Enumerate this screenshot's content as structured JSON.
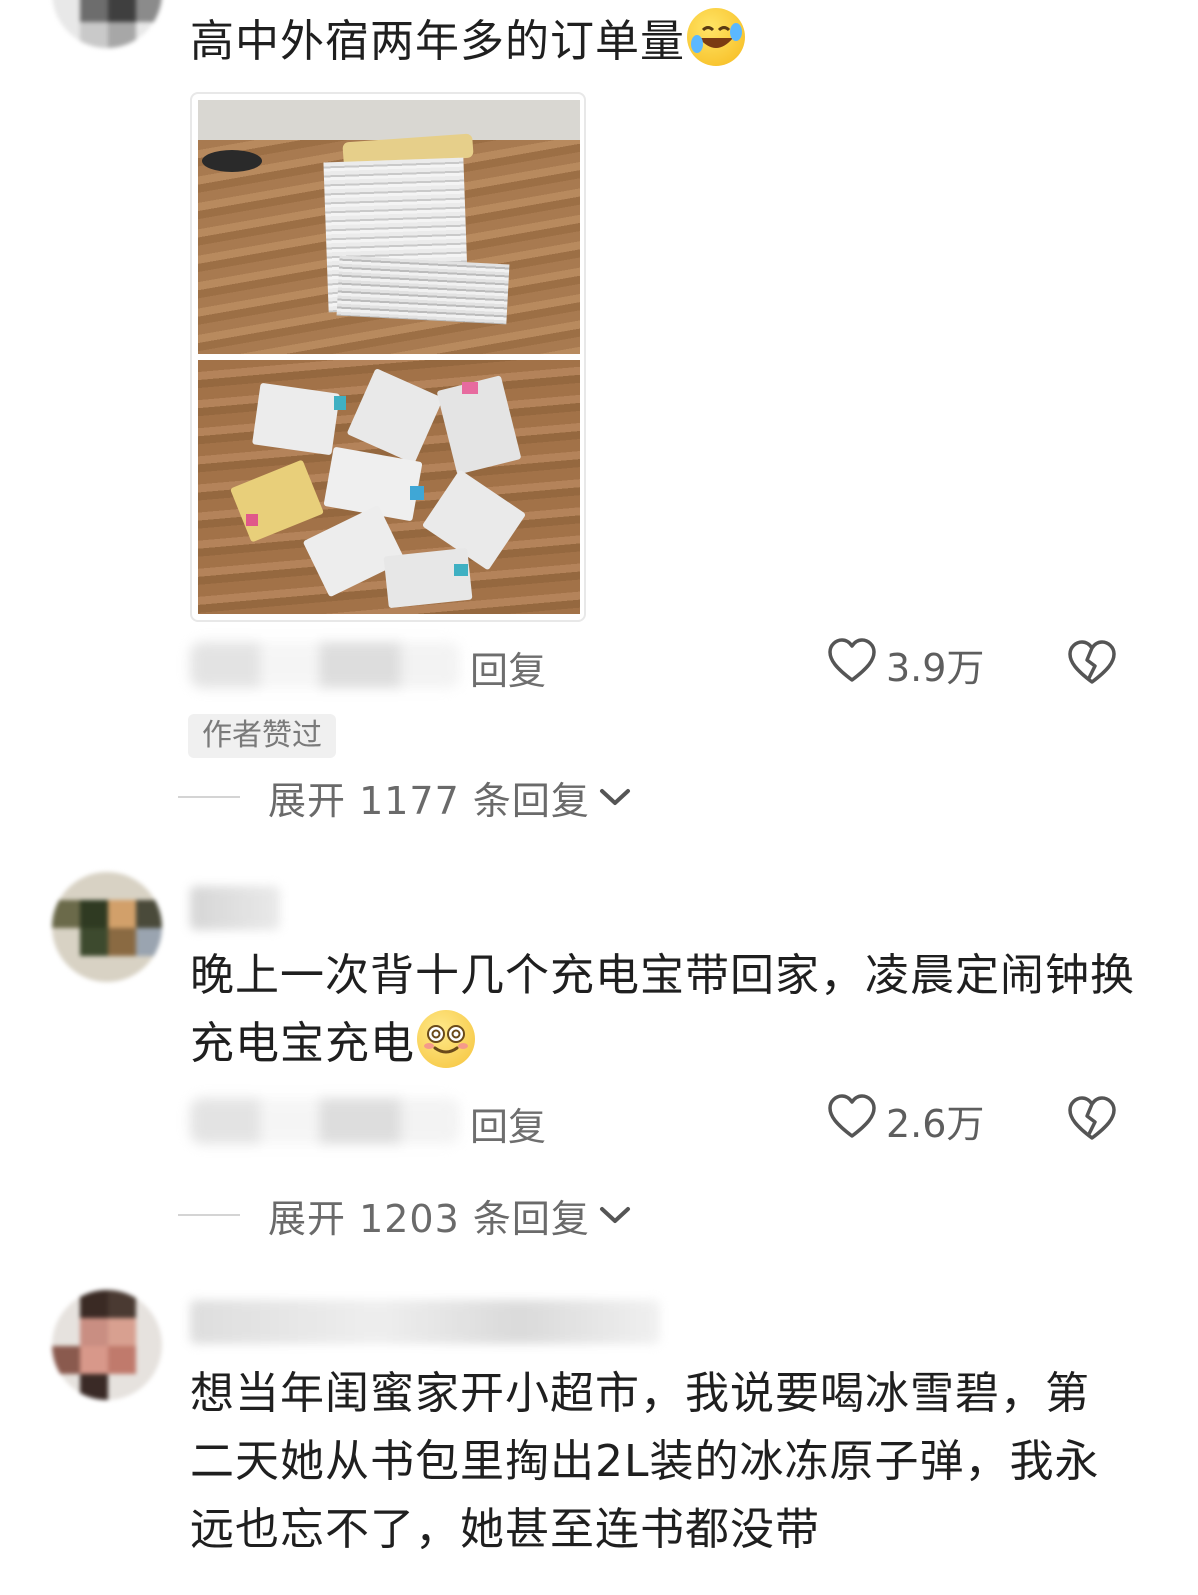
{
  "comments": [
    {
      "text": "高中外宿两年多的订单量",
      "reply_label": "回复",
      "likes": "3.9万",
      "author_liked_tag": "作者赞过",
      "expand_replies": "展开 1177 条回复",
      "emoji": "rofl-emoji"
    },
    {
      "text": "晚上一次背十几个充电宝带回家，凌晨定闹钟换充电宝充电",
      "reply_label": "回复",
      "likes": "2.6万",
      "expand_replies": "展开 1203 条回复",
      "emoji": "dizzy-smile-emoji"
    },
    {
      "text": "想当年闺蜜家开小超市，我说要喝冰雪碧，第二天她从书包里掏出2L装的冰冻原子弹，我永远也忘不了，她甚至连书都没带"
    }
  ],
  "icons": {
    "like": "heart-outline-icon",
    "dislike": "broken-heart-icon",
    "expand": "chevron-down-icon"
  },
  "colors": {
    "text": "#1f1f1f",
    "meta": "#6e6e6e",
    "tag_bg": "#f0f0f0"
  }
}
